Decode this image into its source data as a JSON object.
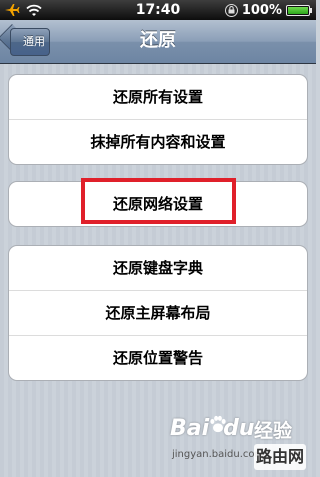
{
  "status_bar": {
    "time": "17:40",
    "battery_text": "100%",
    "battery_level": 1.0,
    "icons": [
      "airplane-icon",
      "wifi-icon",
      "orientation-lock-icon",
      "battery-icon"
    ]
  },
  "nav": {
    "back_label": "通用",
    "title": "还原"
  },
  "groups": [
    {
      "items": [
        "还原所有设置",
        "抹掉所有内容和设置"
      ]
    },
    {
      "items": [
        "还原网络设置"
      ]
    },
    {
      "items": [
        "还原键盘字典",
        "还原主屏幕布局",
        "还原位置警告"
      ]
    }
  ],
  "watermark": {
    "logo_text": "Bai",
    "logo_text_2": "du",
    "product": "经验",
    "url": "jingyan.baidu.com",
    "site": "路由网"
  },
  "colors": {
    "highlight": "#e0202a",
    "nav_bar": "#6d85a3",
    "background": "#c5ccd5"
  }
}
